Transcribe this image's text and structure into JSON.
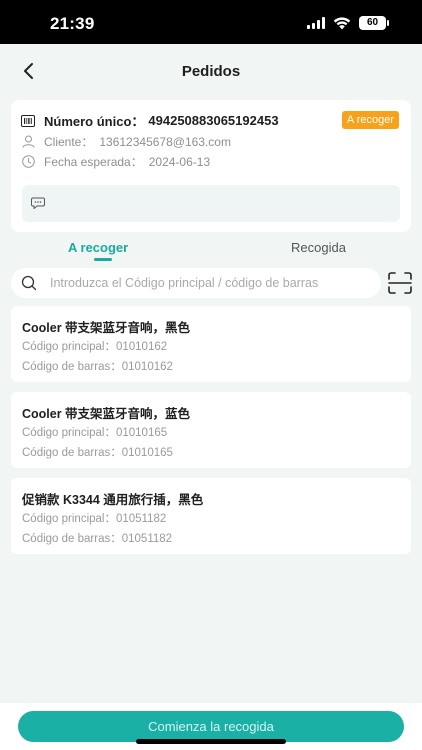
{
  "status_bar": {
    "time": "21:39",
    "battery": "60"
  },
  "nav": {
    "title": "Pedidos"
  },
  "order": {
    "number_label": "Número único：",
    "number_value": "494250883065192453",
    "status": "A recoger",
    "client_label": "Cliente：",
    "client_value": "13612345678@163.com",
    "date_label": "Fecha esperada：",
    "date_value": "2024-06-13"
  },
  "tabs": [
    {
      "label": "A recoger",
      "active": true
    },
    {
      "label": "Recogida",
      "active": false
    }
  ],
  "search": {
    "placeholder": "Introduzca el Código principal / código de barras"
  },
  "items": [
    {
      "title": "Cooler 带支架蓝牙音响，黑色",
      "main_code_label": "Código principal：",
      "main_code": "01010162",
      "barcode_label": "Código de barras：",
      "barcode": "01010162"
    },
    {
      "title": "Cooler 带支架蓝牙音响，蓝色",
      "main_code_label": "Código principal：",
      "main_code": "01010165",
      "barcode_label": "Código de barras：",
      "barcode": "01010165"
    },
    {
      "title": "促销款 K3344 通用旅行插，黑色",
      "main_code_label": "Código principal：",
      "main_code": "01051182",
      "barcode_label": "Código de barras：",
      "barcode": "01051182"
    }
  ],
  "bottom": {
    "button_label": "Comienza la recogida"
  },
  "colors": {
    "accent": "#1aaaa0",
    "badge": "#f6a21a",
    "background": "#f1f6f5"
  }
}
